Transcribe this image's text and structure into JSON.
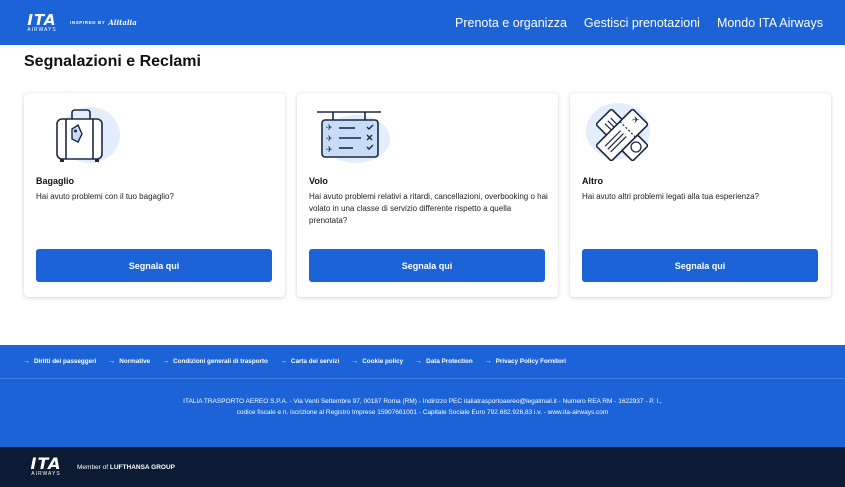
{
  "header": {
    "logo_text": "ITA",
    "logo_sub": "AIRWAYS",
    "inspired_by": "INSPIRED BY",
    "inspired_brand": "Alitalia",
    "nav": [
      "Prenota e organizza",
      "Gestisci prenotazioni",
      "Mondo ITA Airways"
    ]
  },
  "page": {
    "title": "Segnalazioni e Reclami"
  },
  "cards": [
    {
      "title": "Bagaglio",
      "description": "Hai avuto problemi con il tuo bagaglio?",
      "button": "Segnala qui",
      "icon": "luggage-icon"
    },
    {
      "title": "Volo",
      "description": "Hai avuto problemi relativi a ritardi, cancellazioni, overbooking o hai volato in una classe di servizio differente rispetto a quella prenotata?",
      "button": "Segnala qui",
      "icon": "departures-board-icon"
    },
    {
      "title": "Altro",
      "description": "Hai avuto altri problemi legati alla tua esperienza?",
      "button": "Segnala qui",
      "icon": "tickets-icon"
    }
  ],
  "footer": {
    "links": [
      "Diritti dei passeggeri",
      "Normative",
      "Condizioni generali di trasporto",
      "Carta dei servizi",
      "Cookie policy",
      "Data Protection",
      "Privacy Policy Fornitori"
    ],
    "legal": "ITALIA TRASPORTO AEREO S.P.A. - Via Venti Settembre 97, 00187 Roma (RM) - Indirizzo PEC italiatrasportoaereo@legalmail.it - Numero REA RM - 1622937 - P. I., codice fiscale e n. iscrizione al Registro Imprese 15907661001 - Capitale Sociale Euro 792.682.926,83 i.v. - www.ita-airways.com",
    "member_prefix": "Member of",
    "member_group": "LUFTHANSA GROUP"
  },
  "colors": {
    "brand": "#1b63d6",
    "footer_dark": "#0c1b33",
    "icon_bg": "#e3edfb",
    "icon_line": "#1a2a44"
  }
}
